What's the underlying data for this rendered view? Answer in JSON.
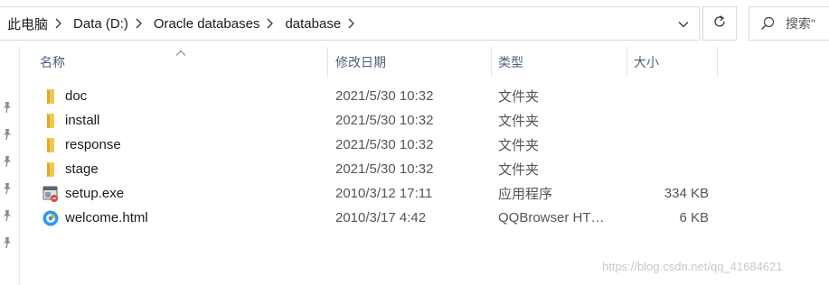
{
  "address_bar": {
    "breadcrumb": [
      "此电脑",
      "Data (D:)",
      "Oracle databases",
      "database"
    ]
  },
  "search": {
    "placeholder": "搜索\""
  },
  "columns": {
    "name": "名称",
    "date": "修改日期",
    "type": "类型",
    "size": "大小"
  },
  "files": [
    {
      "name": "doc",
      "date": "2021/5/30 10:32",
      "type": "文件夹",
      "size": "",
      "icon": "folder-icon"
    },
    {
      "name": "install",
      "date": "2021/5/30 10:32",
      "type": "文件夹",
      "size": "",
      "icon": "folder-icon"
    },
    {
      "name": "response",
      "date": "2021/5/30 10:32",
      "type": "文件夹",
      "size": "",
      "icon": "folder-icon"
    },
    {
      "name": "stage",
      "date": "2021/5/30 10:32",
      "type": "文件夹",
      "size": "",
      "icon": "folder-icon"
    },
    {
      "name": "setup.exe",
      "date": "2010/3/12 17:11",
      "type": "应用程序",
      "size": "334 KB",
      "icon": "exe-icon"
    },
    {
      "name": "welcome.html",
      "date": "2010/3/17 4:42",
      "type": "QQBrowser HT…",
      "size": "6 KB",
      "icon": "qqbrowser-html-icon"
    }
  ],
  "watermark": "https://blog.csdn.net/qq_41684621",
  "colors": {
    "folder": "#f2c94c",
    "header_text": "#4c607a",
    "border": "#d9d9d9"
  }
}
